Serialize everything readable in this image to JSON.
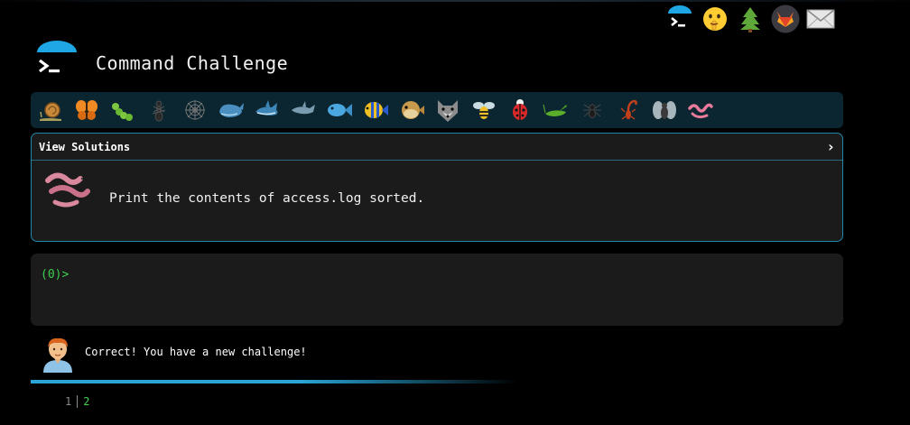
{
  "header": {
    "title": "Command Challenge",
    "icons": [
      "terminal-logo-icon",
      "shushing-face-icon",
      "evergreen-tree-icon",
      "gitlab-fox-icon",
      "envelope-icon"
    ]
  },
  "creatures": [
    "snail",
    "butterfly",
    "caterpillar",
    "ant",
    "spider-web",
    "whale",
    "shark",
    "dolphin",
    "fish",
    "tropical-fish",
    "pufferfish",
    "wolf",
    "bee",
    "ladybug",
    "cricket",
    "spider",
    "scorpion",
    "fly",
    "worm"
  ],
  "challenge": {
    "header_label": "View Solutions",
    "chevron": "›",
    "text": "Print the contents of access.log sorted."
  },
  "terminal": {
    "prompt": "(0)>"
  },
  "feedback": {
    "message": "Correct! You have a new challenge!"
  },
  "progress": {
    "fraction": 0.55
  },
  "pagination": {
    "pages": [
      "1",
      "2"
    ],
    "current": "2"
  },
  "colors": {
    "accent": "#1e88a8",
    "bar_bg": "#0b2630",
    "panel_bg": "#1b1b1b",
    "prompt_green": "#3ccf4e"
  }
}
